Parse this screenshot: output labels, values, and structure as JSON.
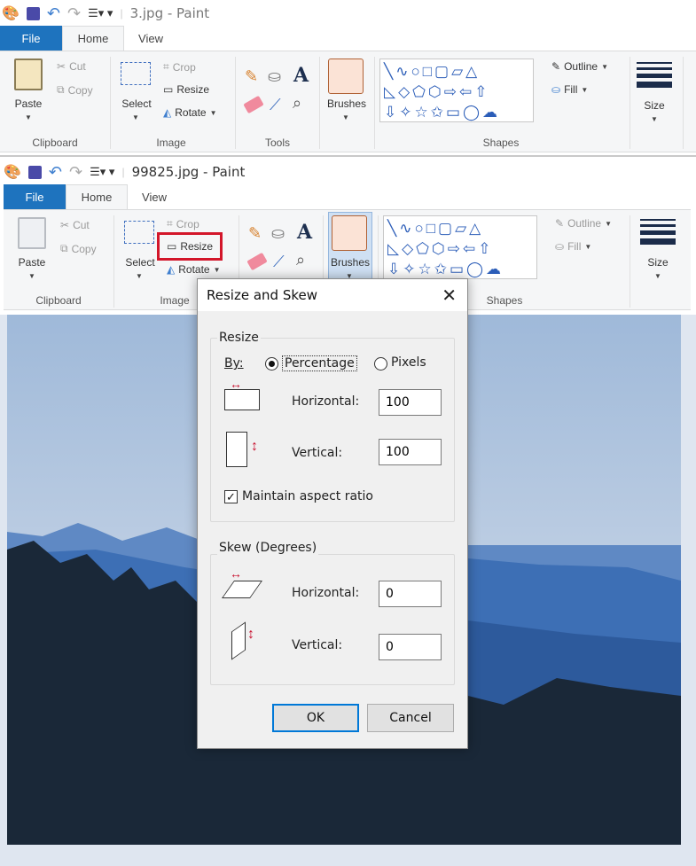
{
  "back_window": {
    "title": "3.jpg - Paint",
    "tabs": {
      "file": "File",
      "home": "Home",
      "view": "View"
    },
    "clipboard": {
      "paste": "Paste",
      "cut": "Cut",
      "copy": "Copy",
      "group": "Clipboard"
    },
    "image": {
      "select": "Select",
      "crop": "Crop",
      "resize": "Resize",
      "rotate": "Rotate",
      "group": "Image"
    },
    "tools": {
      "group": "Tools"
    },
    "brushes": "Brushes",
    "shapes": {
      "outline": "Outline",
      "fill": "Fill",
      "group": "Shapes"
    },
    "size": "Size"
  },
  "front_window": {
    "title": "99825.jpg - Paint",
    "tabs": {
      "file": "File",
      "home": "Home",
      "view": "View"
    },
    "clipboard": {
      "paste": "Paste",
      "cut": "Cut",
      "copy": "Copy",
      "group": "Clipboard"
    },
    "image": {
      "select": "Select",
      "crop": "Crop",
      "resize": "Resize",
      "rotate": "Rotate",
      "group": "Image"
    },
    "brushes": "Brushes",
    "shapes": {
      "outline": "Outline",
      "fill": "Fill",
      "group": "Shapes"
    },
    "size": "Size"
  },
  "dialog": {
    "title": "Resize and Skew",
    "resize_legend": "Resize",
    "by_label": "By:",
    "percentage": "Percentage",
    "pixels": "Pixels",
    "by_selected": "Percentage",
    "horizontal_label": "Horizontal:",
    "vertical_label": "Vertical:",
    "resize_horizontal": "100",
    "resize_vertical": "100",
    "maintain_aspect": "Maintain aspect ratio",
    "maintain_aspect_checked": true,
    "skew_legend": "Skew (Degrees)",
    "skew_horizontal": "0",
    "skew_vertical": "0",
    "ok": "OK",
    "cancel": "Cancel"
  },
  "colors": {
    "file_tab": "#1e73be",
    "highlight": "#d3162a",
    "arrow_red": "#c8102e",
    "size_bars": "#1b2c4a"
  }
}
